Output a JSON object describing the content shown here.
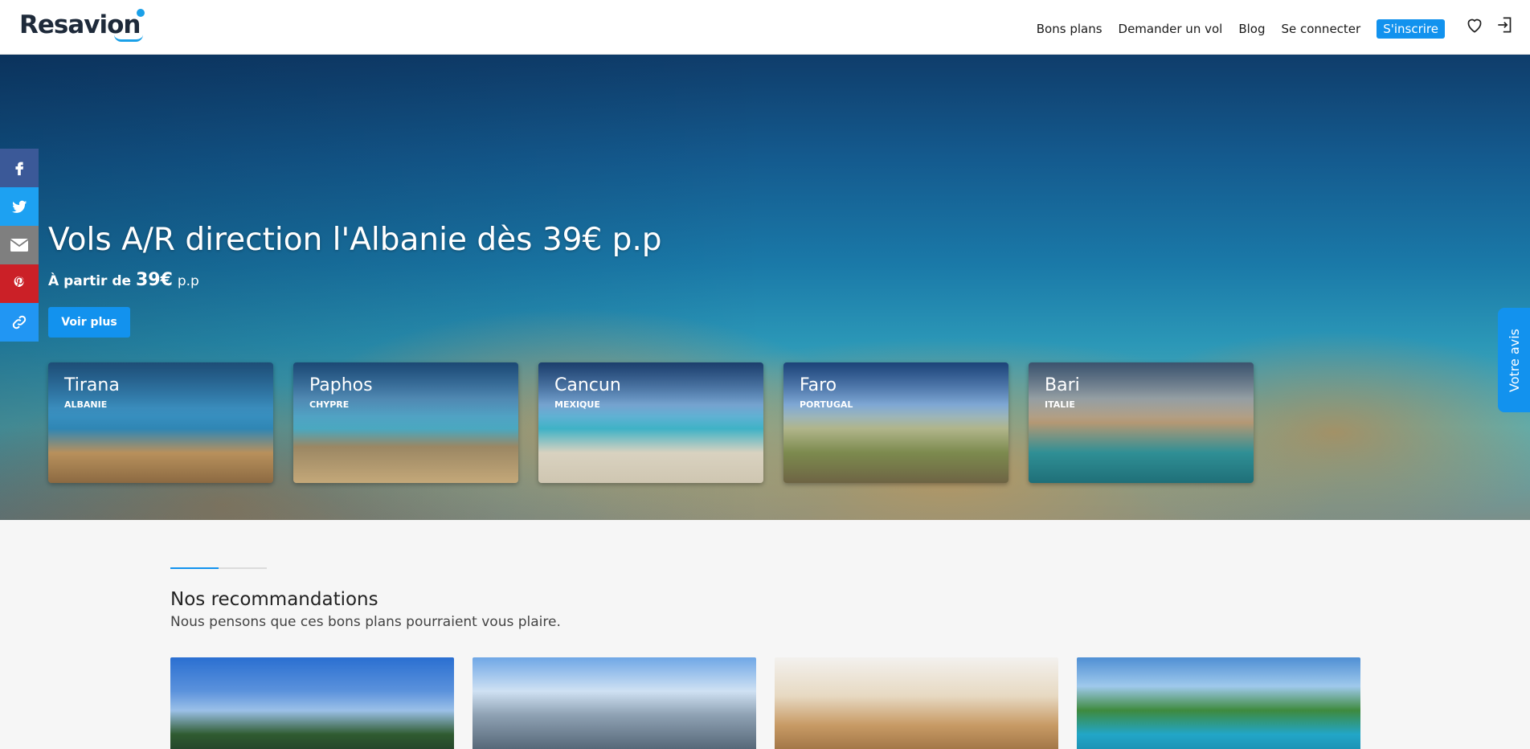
{
  "brand": {
    "logo_text": "Resavion",
    "accent_color": "#1292ee"
  },
  "nav": {
    "items": [
      "Bons plans",
      "Demander un vol",
      "Blog",
      "Se connecter"
    ],
    "signup_label": "S'inscrire",
    "favorites_icon": "heart-icon",
    "login_icon": "login-icon"
  },
  "hero": {
    "title": "Vols A/R direction l'Albanie dès 39€ p.p",
    "subtitle_prefix": "À partir de",
    "price": "39€",
    "price_suffix": "p.p",
    "cta_label": "Voir plus",
    "destinations": [
      {
        "city": "Tirana",
        "country": "ALBANIE"
      },
      {
        "city": "Paphos",
        "country": "CHYPRE"
      },
      {
        "city": "Cancun",
        "country": "MEXIQUE"
      },
      {
        "city": "Faro",
        "country": "PORTUGAL"
      },
      {
        "city": "Bari",
        "country": "ITALIE"
      }
    ]
  },
  "social": {
    "icons": [
      "facebook-icon",
      "twitter-icon",
      "mail-icon",
      "pinterest-icon",
      "link-icon"
    ],
    "colors": {
      "facebook": "#3b5998",
      "twitter": "#1da1f2",
      "mail": "#7f7f7f",
      "pinterest": "#cb2027",
      "link": "#2196f3"
    }
  },
  "feedback": {
    "label": "Votre avis"
  },
  "recommendations": {
    "title": "Nos recommandations",
    "subtitle": "Nous pensons que ces bons plans pourraient vous plaire."
  }
}
